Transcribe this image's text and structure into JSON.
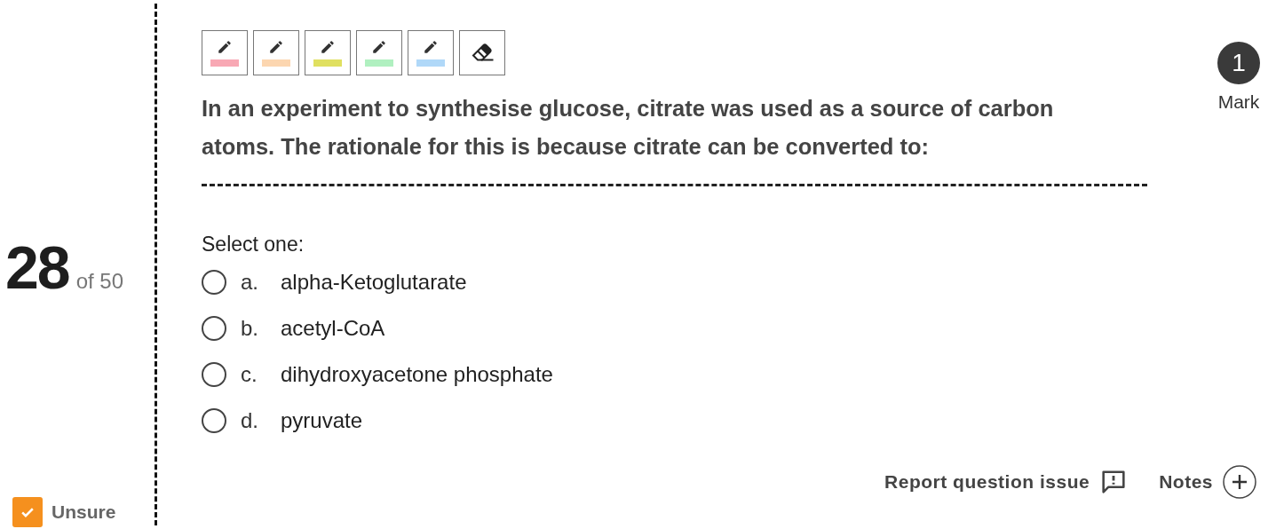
{
  "question_number": "28",
  "question_total": "of 50",
  "unsure": {
    "label": "Unsure",
    "checked": true
  },
  "highlighters": [
    {
      "kind": "pen",
      "color": "#f8a8b4"
    },
    {
      "kind": "pen",
      "color": "#fcd6b0"
    },
    {
      "kind": "pen",
      "color": "#e0e060"
    },
    {
      "kind": "pen",
      "color": "#b0f0c0"
    },
    {
      "kind": "pen",
      "color": "#b0d8f8"
    },
    {
      "kind": "eraser"
    }
  ],
  "marks": {
    "value": "1",
    "label": "Mark"
  },
  "question": "In an experiment to synthesise glucose, citrate was used as a source of carbon atoms. The rationale for this is because citrate can be converted to:",
  "prompt": "Select one:",
  "options": [
    {
      "letter": "a.",
      "text": "alpha-Ketoglutarate",
      "selected": false
    },
    {
      "letter": "b.",
      "text": "acetyl-CoA",
      "selected": false
    },
    {
      "letter": "c.",
      "text": "dihydroxyacetone phosphate",
      "selected": false
    },
    {
      "letter": "d.",
      "text": "pyruvate",
      "selected": false
    }
  ],
  "report_label": "Report question issue",
  "notes_label": "Notes"
}
